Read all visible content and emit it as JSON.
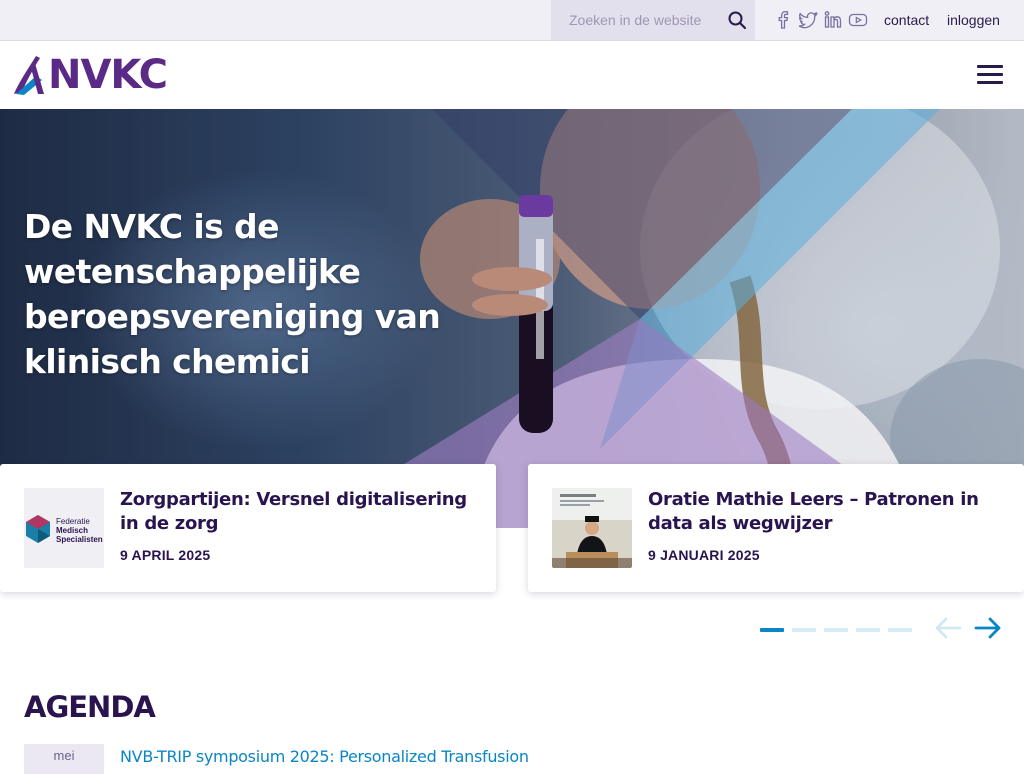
{
  "topbar": {
    "search_placeholder": "Zoeken in de website",
    "contact_label": "contact",
    "login_label": "inloggen",
    "socials": [
      "facebook-icon",
      "twitter-icon",
      "linkedin-icon",
      "youtube-icon"
    ]
  },
  "header": {
    "logo_text": "NVKC"
  },
  "hero": {
    "title": "De NVKC is de wetenschappelijke beroepsvereniging van klinisch chemici"
  },
  "news": [
    {
      "title": "Zorgpartijen: Versnel digitalisering in de zorg",
      "date": "9 APRIL 2025",
      "thumb_logo_line1": "Federatie",
      "thumb_logo_line2": "Medisch",
      "thumb_logo_line3": "Specialisten"
    },
    {
      "title": "Oratie Mathie Leers – Patronen in data als wegwijzer",
      "date": "9 JANUARI 2025"
    }
  ],
  "carousel": {
    "slide_count": 5,
    "active_slide": 1
  },
  "agenda": {
    "heading": "AGENDA",
    "items": [
      {
        "month": "mei",
        "title": "NVB-TRIP symposium 2025: Personalized Transfusion"
      }
    ]
  },
  "colors": {
    "brand_purple": "#5a2a86",
    "dark_text": "#2a1450",
    "accent_blue": "#0a86c6",
    "topbar_bg": "#f1eff6"
  }
}
